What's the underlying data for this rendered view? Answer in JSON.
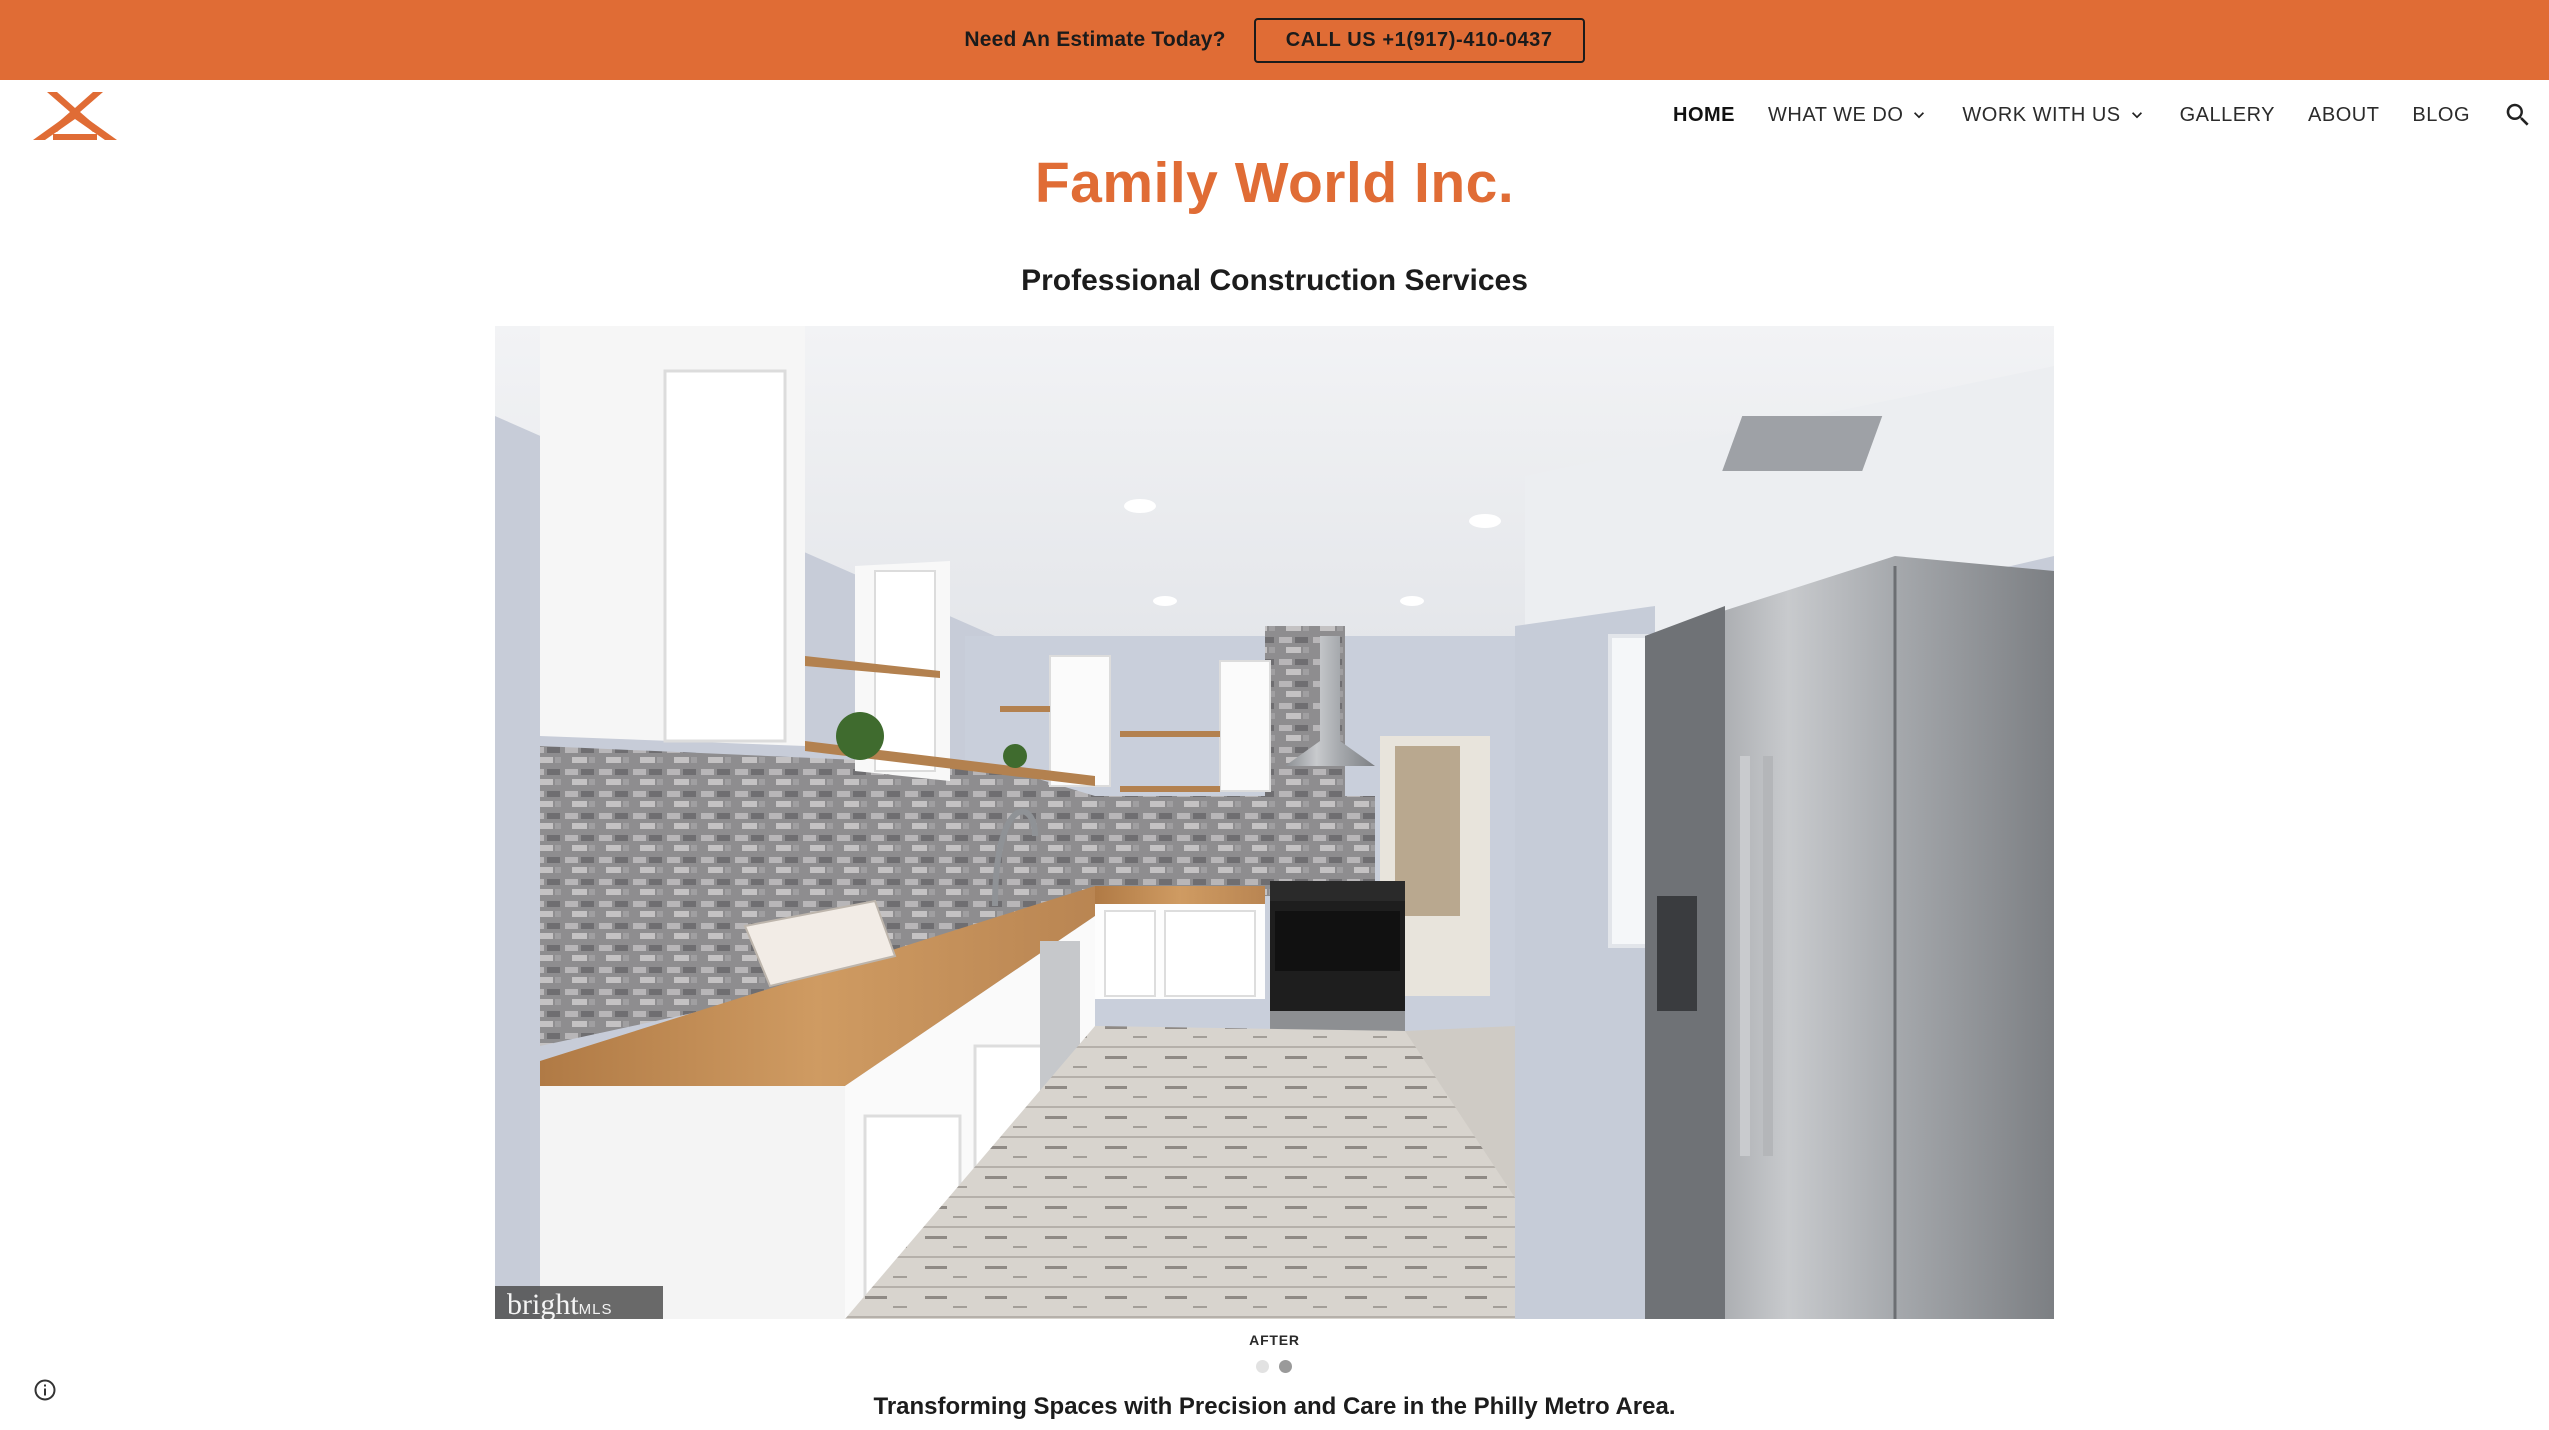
{
  "banner": {
    "text": "Need An Estimate Today?",
    "button_label": "CALL US +1(917)-410-0437",
    "bg_color": "#e06c35"
  },
  "nav": {
    "items": [
      {
        "label": "HOME",
        "active": true
      },
      {
        "label": "WHAT WE DO",
        "dropdown": true
      },
      {
        "label": "WORK WITH US",
        "dropdown": true
      },
      {
        "label": "GALLERY"
      },
      {
        "label": "ABOUT"
      },
      {
        "label": "BLOG"
      }
    ],
    "search_icon": "search-icon",
    "logo_icon": "house-logo-icon"
  },
  "hero": {
    "title": "Family World Inc.",
    "subtitle": "Professional Construction Services",
    "title_color": "#e06c35"
  },
  "carousel": {
    "caption": "AFTER",
    "watermark": "bright",
    "watermark_suffix": "MLS",
    "slide_count": 2,
    "active_slide": 2
  },
  "tagline": "Transforming Spaces with Precision and Care in the Philly Metro Area."
}
